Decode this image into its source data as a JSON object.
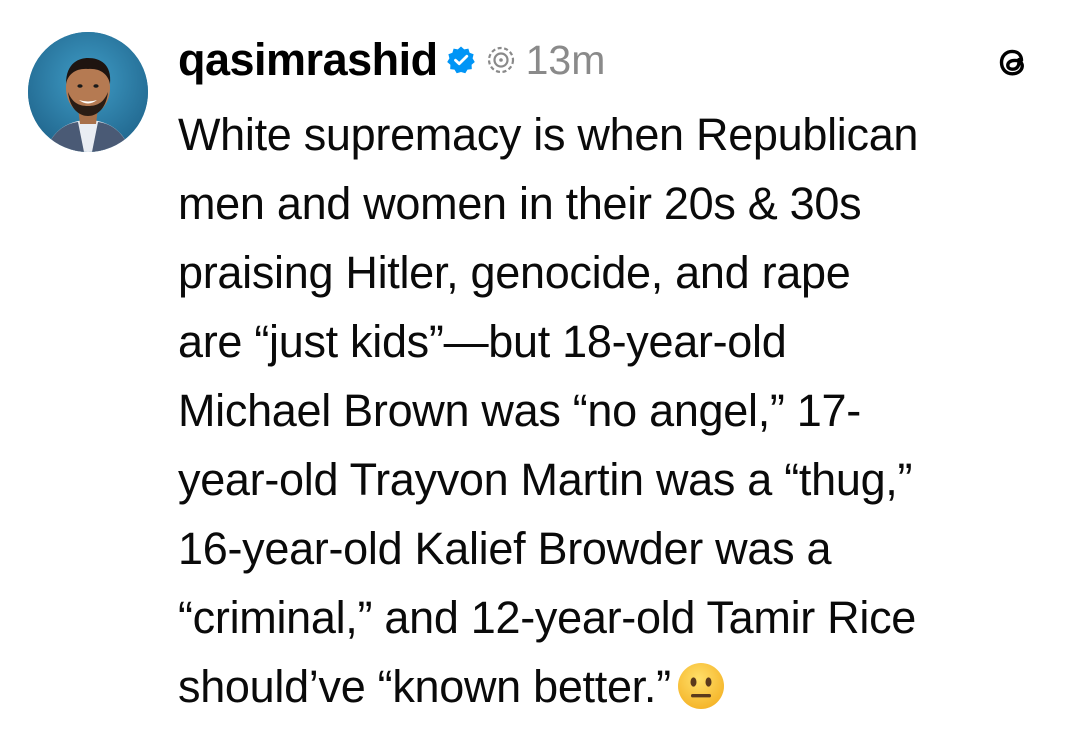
{
  "post": {
    "username": "qasimrashid",
    "timestamp": "13m",
    "lines": [
      "White supremacy is when Republican",
      "men and women in their 20s & 30s",
      "praising Hitler, genocide, and rape",
      "are “just kids”—but 18-year-old",
      "Michael Brown was “no angel,” 17-",
      "year-old Trayvon Martin was a “thug,”",
      "16-year-old Kalief Browder was a",
      "“criminal,” and 12-year-old Tamir Rice",
      "should’ve “known better.”"
    ],
    "emoji": "neutral-face"
  },
  "icons": {
    "verified": "verified-badge-icon",
    "thread": "thread-status-icon",
    "logo": "threads-logo-icon"
  },
  "colors": {
    "verified_blue": "#0095f6",
    "timestamp_gray": "#8a8a8a",
    "avatar_bg": "#2c7fa6"
  }
}
